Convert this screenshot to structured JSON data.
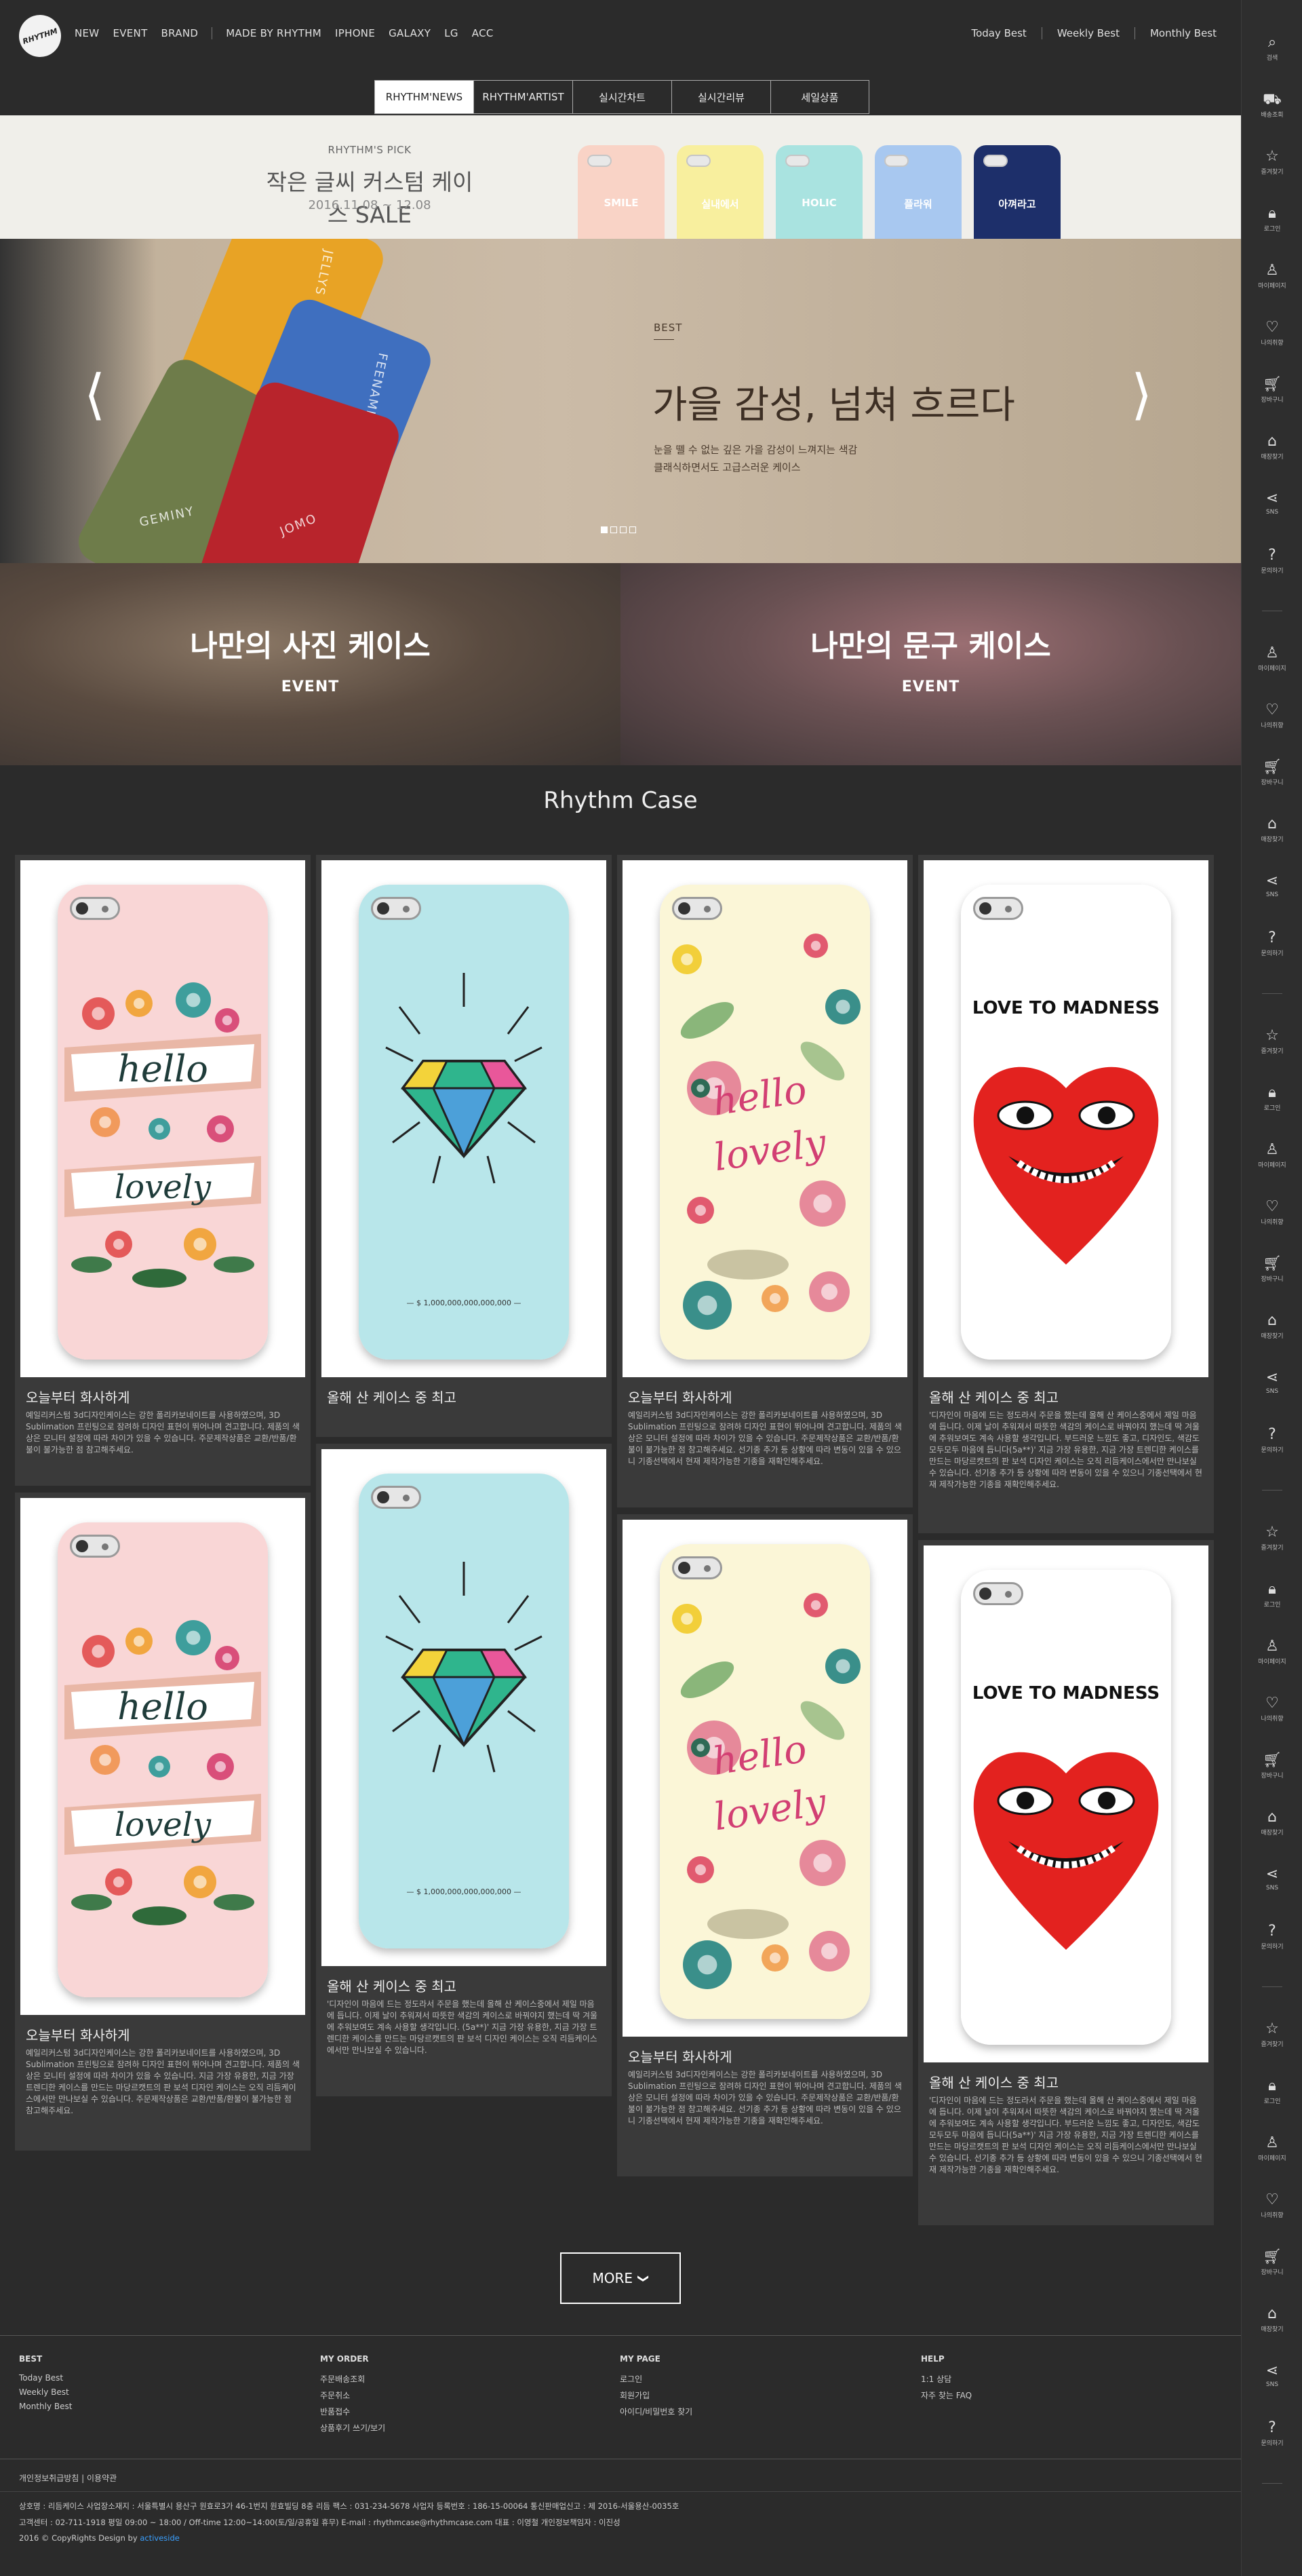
{
  "header": {
    "logo_text": "RHYTHM",
    "nav": [
      "NEW",
      "EVENT",
      "BRAND",
      "MADE BY RHYTHM",
      "IPHONE",
      "GALAXY",
      "LG",
      "ACC"
    ],
    "best_links": [
      "Today Best",
      "Weekly Best",
      "Monthly Best"
    ],
    "tabs": [
      "RHYTHM'NEWS",
      "RHYTHM'ARTIST",
      "실시간차트",
      "실시간리뷰",
      "세일상품"
    ]
  },
  "promo": {
    "kicker": "RHYTHM'S PICK",
    "title": "작은 글씨 커스텀 케이스 SALE",
    "date": "2016.11.08 ~ 12.08",
    "cases": [
      {
        "label": "SMILE",
        "color": "#f9d3c6"
      },
      {
        "label": "실내에서",
        "color": "#f8ef9e"
      },
      {
        "label": "HOLIC",
        "color": "#a9e3e0"
      },
      {
        "label": "플라워",
        "color": "#a8c8f0"
      },
      {
        "label": "아껴라고",
        "color": "#1d2f6a"
      }
    ]
  },
  "hero": {
    "kicker": "BEST",
    "title": "가을 감성, 넘쳐 흐르다",
    "desc1": "눈을 뗄 수 없는 깊은 가을 감성이 느껴지는 색감",
    "desc2": "클래식하면서도 고급스러운 케이스",
    "case_names": [
      "JELLYS",
      "FEENAMI",
      "GEMINY",
      "JOMO"
    ],
    "prev_arrow": "⟨",
    "next_arrow": "⟩",
    "slide_count": 4,
    "active_slide": 1
  },
  "events": [
    {
      "title": "나만의 사진 케이스",
      "sub": "EVENT"
    },
    {
      "title": "나만의 문구 케이스",
      "sub": "EVENT"
    }
  ],
  "section": {
    "title": "Rhythm Case"
  },
  "products": [
    {
      "title": "오늘부터 화사하게",
      "design": "hello",
      "desc": "예일리커스텀 3d디자인케이스는 강한 폴리카보네이트를 사용하였으며, 3D Sublimation 프린팅으로 잠려하 디자인 표현이 뛰어나며 견고합니다. 제품의 색상은 모니터 설정에 따라 차이가 있을 수 있습니다. 주문제작상품은 교환/반품/환불이 불가능한 점 참고해주세요."
    },
    {
      "title": "올해 산 케이스 중 최고",
      "design": "diamond",
      "desc": ""
    },
    {
      "title": "오늘부터 화사하게",
      "design": "lovely",
      "desc": "예일리커스텀 3d디자인케이스는 강한 폴리카보네이트를 사용하였으며, 3D Sublimation 프린팅으로 잠려하 디자인 표현이 뛰어나며 견고합니다. 제품의 색상은 모니터 설정에 따라 차이가 있을 수 있습니다. 주문제작상품은 교환/반품/환불이 불가능한 점 참고해주세요. 선기종 추가 등 상황에 따라 변동이 있을 수 있으니 기종선택에서 현재 제작가능한 기종을 재확인해주세요."
    },
    {
      "title": "올해 산 케이스 중 최고",
      "design": "madness",
      "desc": "'디자인이 마음에 드는 정도라서 주문을 했는데 올해 산 케이스중에서 제일 마음에 듭니다. 이제 날이 추워져서 따뜻한 색감의 케이스로 바꿔야지 했는데 딱 겨울에 추워보여도 계속 사용할 생각입니다. 부드러운 느낌도 좋고, 디자인도, 색감도 모두모두 마음에 듭니다(5a**)' 지금 가장 유용한, 지금 가장 트렌디한 케이스를 만드는 마당르캣트의 판 보석 디자인 케이스는 오직 리듬케이스에서만 만나보실 수 있습니다. 선기종 추가 등 상황에 따라 변동이 있을 수 있으니 기종선택에서 현재 제작가능한 기종을 재확인해주세요."
    },
    {
      "title": "오늘부터 화사하게",
      "design": "hello",
      "desc": "예일리커스텀 3d디자인케이스는 강한 폴리카보네이트를 사용하였으며, 3D Sublimation 프린팅으로 잠려하 디자인 표현이 뛰어나며 견고합니다. 제품의 색상은 모니터 설정에 따라 차이가 있을 수 있습니다. 지금 가장 유용한, 지금 가장 트렌디한 케이스를 만드는 마당르캣트의 판 보석 디자인 케이스는 오직 리듬케이스에서만 만나보실 수 있습니다. 주문제작상품은 교환/반품/환불이 불가능한 점 참고해주세요."
    },
    {
      "title": "올해 산 케이스 중 최고",
      "design": "diamond",
      "desc": "'디자인이 마음에 드는 정도라서 주문을 했는데 올해 산 케이스중에서 제일 마음에 듭니다. 이제 날이 추워져서 따뜻한 색감의 케이스로 바꿔야지 했는데 딱 겨울에 추워보여도 계속 사용할 생각입니다. (5a**)' 지금 가장 유용한, 지금 가장 트렌디한 케이스를 만드는 마당르캣트의 판 보석 디자인 케이스는 오직 리듬케이스에서만 만나보실 수 있습니다."
    },
    {
      "title": "오늘부터 화사하게",
      "design": "lovely",
      "desc": "예일리커스텀 3d디자인케이스는 강한 폴리카보네이트를 사용하였으며, 3D Sublimation 프린팅으로 잠려하 디자인 표현이 뛰어나며 견고합니다. 제품의 색상은 모니터 설정에 따라 차이가 있을 수 있습니다. 주문제작상품은 교환/반품/환불이 불가능한 점 참고해주세요. 선기종 추가 등 상황에 따라 변동이 있을 수 있으니 기종선택에서 현재 제작가능한 기종을 재확인해주세요."
    },
    {
      "title": "올해 산 케이스 중 최고",
      "design": "madness",
      "desc": "'디자인이 마음에 드는 정도라서 주문을 했는데 올해 산 케이스중에서 제일 마음에 듭니다. 이제 날이 추워져서 따뜻한 색감의 케이스로 바꿔야지 했는데 딱 겨울에 추워보여도 계속 사용할 생각입니다. 부드러운 느낌도 좋고, 디자인도, 색감도 모두모두 마음에 듭니다(5a**)' 지금 가장 유용한, 지금 가장 트렌디한 케이스를 만드는 마당르캣트의 판 보석 디자인 케이스는 오직 리듬케이스에서만 만나보실 수 있습니다. 선기종 추가 등 상황에 따라 변동이 있을 수 있으니 기종선택에서 현재 제작가능한 기종을 재확인해주세요."
    }
  ],
  "case_text": {
    "hello": "hello",
    "lovely_word": "lovely",
    "lovely_script": "hello lovely",
    "madness": "LOVE TO MADNESS",
    "diamond_price": "— $ 1,000,000,000,000,000 —"
  },
  "more": {
    "label": "MORE",
    "chevron": "❯"
  },
  "footer": {
    "columns": [
      {
        "head": "BEST",
        "links": [
          "Today Best",
          "Weekly Best",
          "Monthly Best"
        ]
      },
      {
        "head": "MY ORDER",
        "links": [
          "주문배송조회",
          "주문취소",
          "반품접수",
          "상품후기 쓰기/보기"
        ]
      },
      {
        "head": "MY PAGE",
        "links": [
          "로그인",
          "회원가입",
          "아이디/비밀번호 찾기"
        ]
      },
      {
        "head": "HELP",
        "links": [
          "1:1 상담",
          "자주 찾는 FAQ"
        ]
      }
    ],
    "policy": "개인정보취급방침  |  이용약관",
    "info1": "상호명 : 리듬케이스    사업장소재지 : 서울특별시 용산구 원효로3가 46-1번지 원효빌딩 8층 리듬    팩스 : 031-234-5678    사업자 등록번호 : 186-15-00064    통신판매업신고 : 제 2016-서울용산-0035호",
    "info2": "고객센터 : 02-711-1918    평일 09:00 ~ 18:00 /   Off-time 12:00~14:00(토/일/공휴일 휴무)    E-mail : rhythmcase@rhythmcase.com    대표 : 이영철    개인정보책임자 : 이진성",
    "info3": "2016 © CopyRights    Design by",
    "designer": "activeside"
  },
  "sidebar": {
    "top": [
      {
        "icon": "search-icon",
        "glyph": "⌕",
        "label": "검색"
      },
      {
        "icon": "truck-icon",
        "glyph": "⛟",
        "label": "배송조회"
      },
      {
        "icon": "star-icon",
        "glyph": "☆",
        "label": "즐겨찾기"
      },
      {
        "icon": "lock-icon",
        "glyph": "🔒︎",
        "label": "로그인"
      },
      {
        "icon": "user-icon",
        "glyph": "♙",
        "label": "마이페이지"
      },
      {
        "icon": "heart-icon",
        "glyph": "♡",
        "label": "나의취향"
      },
      {
        "icon": "cart-icon",
        "glyph": "🛒︎",
        "label": "장바구니"
      },
      {
        "icon": "store-icon",
        "glyph": "⌂",
        "label": "매장찾기"
      },
      {
        "icon": "share-icon",
        "glyph": "⋖",
        "label": "SNS"
      },
      {
        "icon": "help-icon",
        "glyph": "?",
        "label": "문의하기"
      }
    ]
  }
}
